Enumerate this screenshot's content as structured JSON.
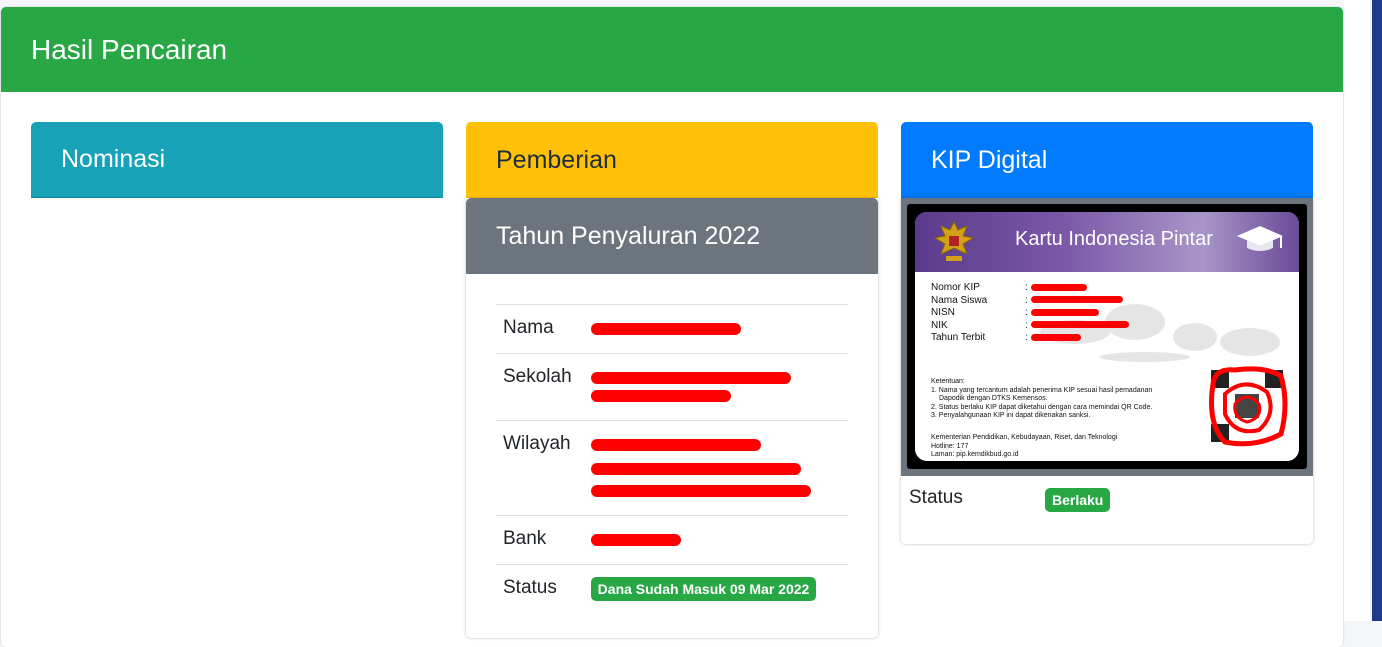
{
  "page": {
    "title": "Hasil Pencairan"
  },
  "nominasi": {
    "title": "Nominasi"
  },
  "pemberian": {
    "title": "Pemberian",
    "subtitle": "Tahun Penyaluran 2022",
    "rows": {
      "nama_label": "Nama",
      "sekolah_label": "Sekolah",
      "wilayah_label": "Wilayah",
      "bank_label": "Bank",
      "status_label": "Status",
      "status_value": "Dana Sudah Masuk 09 Mar 2022"
    }
  },
  "kip": {
    "title": "KIP Digital",
    "card_title": "Kartu Indonesia Pintar",
    "fields": {
      "nomor": "Nomor KIP",
      "nama": "Nama Siswa",
      "nisn": "NISN",
      "nik": "NIK",
      "tahun": "Tahun Terbit"
    },
    "ketentuan_title": "Ketentuan:",
    "ketentuan": [
      "1. Nama yang tercantum adalah penerima KIP sesuai hasil pemadanan",
      "Dapodik dengan DTKS Kemensos.",
      "2. Status berlaku KIP dapat diketahui dengan cara memindai QR Code.",
      "3. Penyalahgunaan KIP ini dapat dikenakan sanksi."
    ],
    "footer": [
      "Kementerian Pendidikan, Kebudayaan, Riset, dan Teknologi",
      "Hotline: 177",
      "Laman: pip.kemdikbud.go.id"
    ],
    "status_label": "Status",
    "status_value": "Berlaku"
  },
  "colors": {
    "success": "#28a745",
    "info": "#17a2b8",
    "warning": "#ffc107",
    "primary": "#007bff",
    "secondary": "#6c757d",
    "redaction": "#ff0000"
  }
}
